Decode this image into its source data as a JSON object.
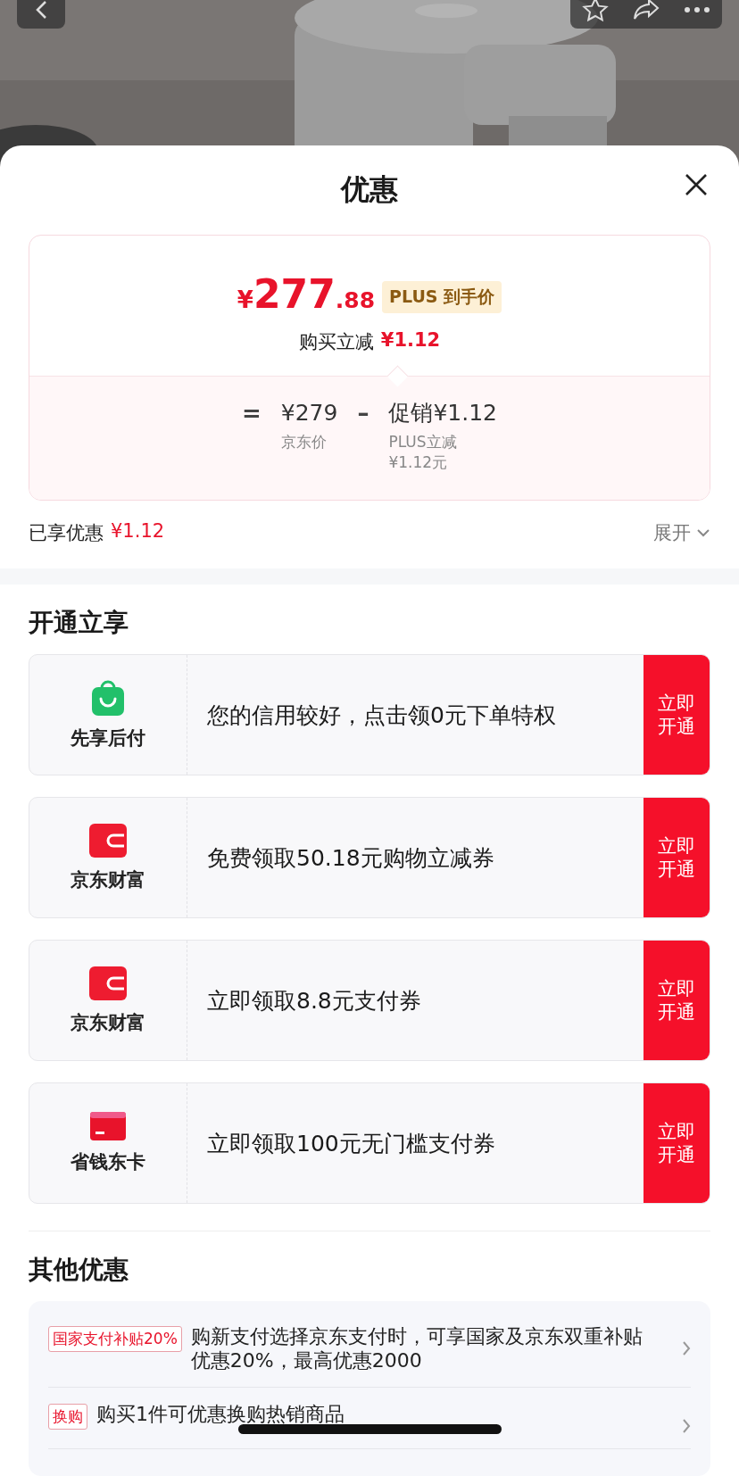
{
  "sheet": {
    "title": "优惠",
    "price_card": {
      "currency": "¥",
      "integer": "277",
      "decimal": ".88",
      "badge": "PLUS 到手价",
      "reduction_label": "购买立减",
      "reduction_value": "¥1.12",
      "formula": [
        {
          "kind": "operator",
          "text": "="
        },
        {
          "kind": "term",
          "value": "¥279",
          "label": [
            "京东价"
          ]
        },
        {
          "kind": "operator",
          "text": "–"
        },
        {
          "kind": "term",
          "value": "促销¥1.12",
          "label": [
            "PLUS立减",
            "¥1.12元"
          ]
        }
      ]
    },
    "summary": {
      "label": "已享优惠",
      "value": "¥1.12",
      "expand": "展开"
    },
    "open_section": {
      "title": "开通立享",
      "items": [
        {
          "kind": "bag",
          "name": "先享后付",
          "text": "您的信用较好，点击领0元下单特权",
          "button": "立即开通"
        },
        {
          "kind": "wallet",
          "name": "京东财富",
          "text": "免费领取50.18元购物立减券",
          "button": "立即开通"
        },
        {
          "kind": "wallet",
          "name": "京东财富",
          "text": "立即领取8.8元支付券",
          "button": "立即开通"
        },
        {
          "kind": "card",
          "name": "省钱东卡",
          "text": "立即领取100元无门槛支付券",
          "button": "立即开通"
        }
      ]
    },
    "other_section": {
      "title": "其他优惠",
      "items": [
        {
          "tag": "国家支付补贴20%",
          "text": "购新支付选择京东支付时，可享国家及京东双重补贴优惠20%，最高优惠2000"
        },
        {
          "tag": "换购",
          "text": "购买1件可优惠换购热销商品"
        }
      ]
    }
  }
}
